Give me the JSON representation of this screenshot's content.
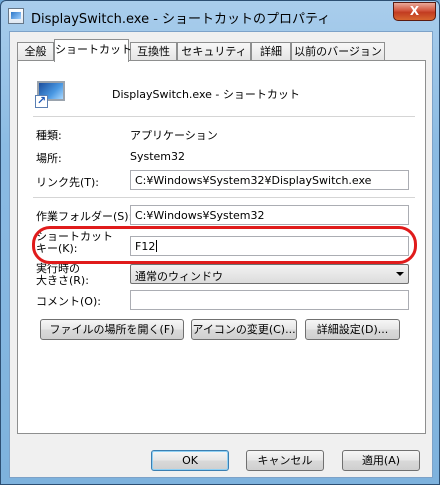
{
  "window": {
    "title": "DisplaySwitch.exe - ショートカットのプロパティ",
    "close_glyph": "X"
  },
  "tabs": [
    {
      "label": "全般",
      "active": false
    },
    {
      "label": "ショートカット",
      "active": true
    },
    {
      "label": "互換性",
      "active": false
    },
    {
      "label": "セキュリティ",
      "active": false
    },
    {
      "label": "詳細",
      "active": false
    },
    {
      "label": "以前のバージョン",
      "active": false
    }
  ],
  "shortcut": {
    "name": "DisplaySwitch.exe - ショートカット",
    "type_label": "種類:",
    "type_value": "アプリケーション",
    "location_label": "場所:",
    "location_value": "System32",
    "target_label": "リンク先(T):",
    "target_value": "C:¥Windows¥System32¥DisplaySwitch.exe",
    "start_in_label": "作業フォルダー(S):",
    "start_in_value": "C:¥Windows¥System32",
    "hotkey_label_line1": "ショートカット",
    "hotkey_label_line2": "キー(K):",
    "hotkey_value": "F12",
    "run_label_line1": "実行時の",
    "run_label_line2": "大きさ(R):",
    "run_value": "通常のウィンドウ",
    "comment_label": "コメント(O):",
    "comment_value": ""
  },
  "actions": {
    "open_location": "ファイルの場所を開く(F)",
    "change_icon": "アイコンの変更(C)...",
    "advanced": "詳細設定(D)..."
  },
  "footer": {
    "ok": "OK",
    "cancel": "キャンセル",
    "apply": "適用(A)"
  },
  "colors": {
    "highlight": "#e01b1b",
    "titlebar": "#8bbbe3"
  }
}
